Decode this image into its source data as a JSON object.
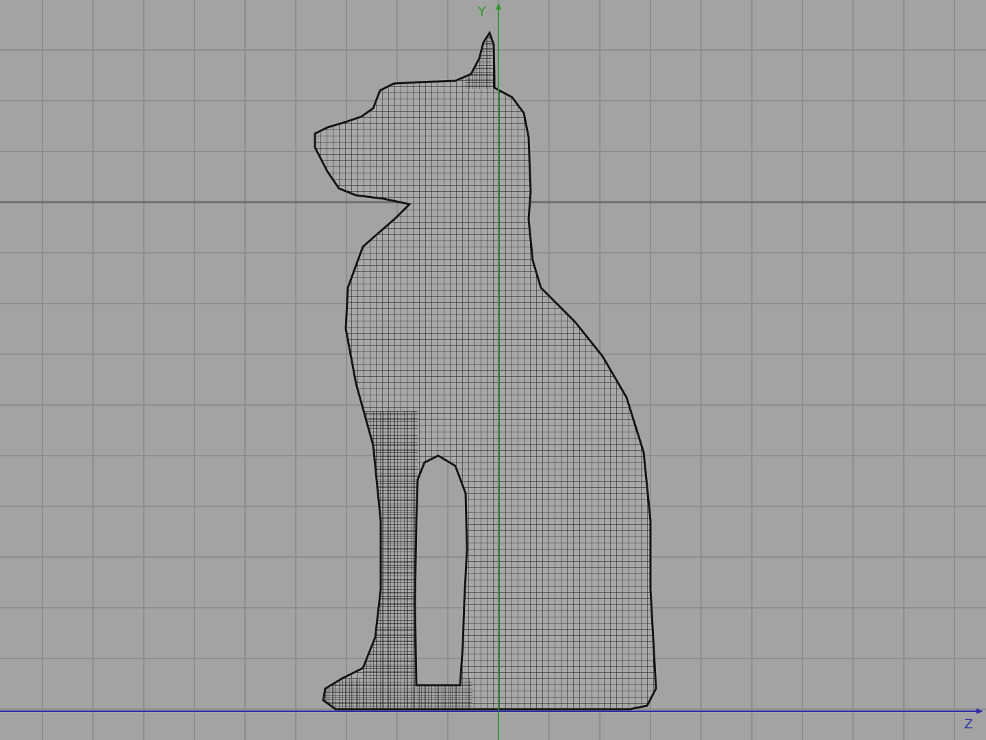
{
  "viewport": {
    "view": "side",
    "background": "#a3a3a3",
    "grid_color": "#8e8e8e",
    "horizon_color": "#6d6d6d",
    "mesh_color": "#141414",
    "axes": {
      "y": {
        "label": "Y",
        "color": "#2f9a2f"
      },
      "z": {
        "label": "Z",
        "color": "#2b2ba8"
      }
    },
    "model": {
      "type": "wireframe-mesh",
      "subject": "seated-cat-icon"
    }
  }
}
